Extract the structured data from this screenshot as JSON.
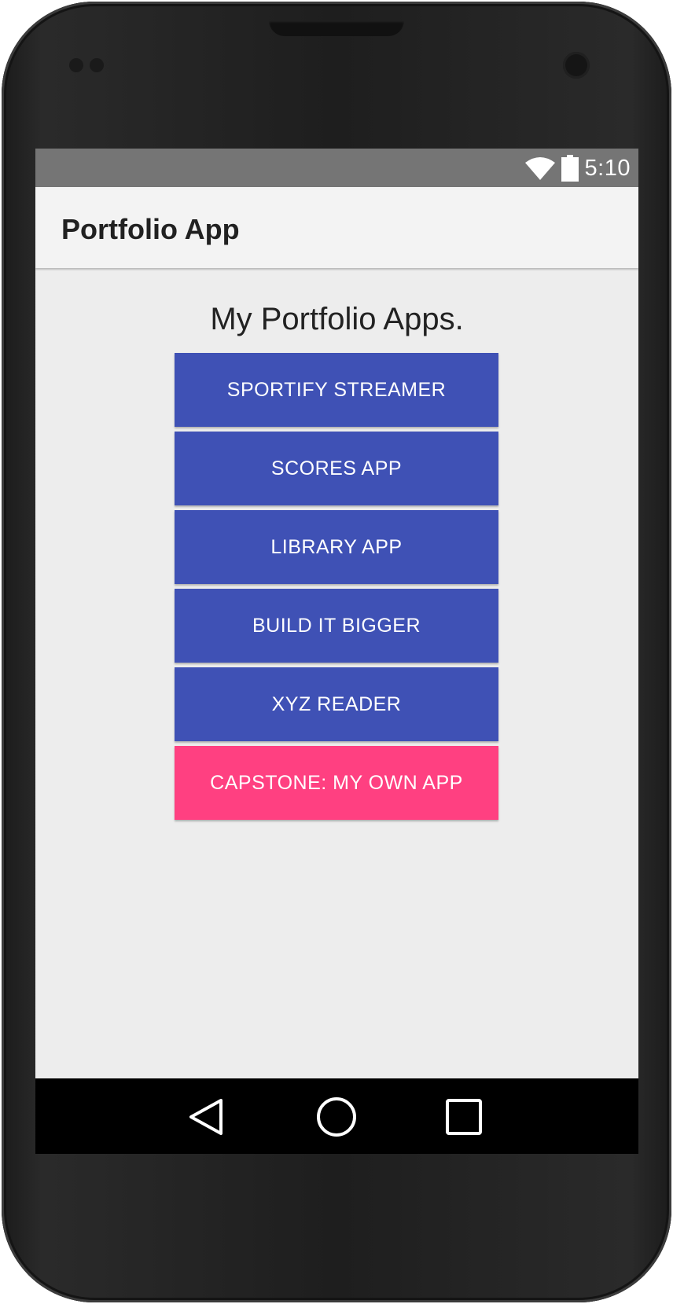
{
  "status_bar": {
    "time": "5:10",
    "icons": [
      "wifi-icon",
      "battery-icon"
    ]
  },
  "app_bar": {
    "title": "Portfolio App"
  },
  "main": {
    "heading": "My Portfolio Apps.",
    "buttons": [
      {
        "label": "SPORTIFY STREAMER",
        "color": "#3f51b5"
      },
      {
        "label": "SCORES APP",
        "color": "#3f51b5"
      },
      {
        "label": "LIBRARY APP",
        "color": "#3f51b5"
      },
      {
        "label": "BUILD IT BIGGER",
        "color": "#3f51b5"
      },
      {
        "label": "XYZ READER",
        "color": "#3f51b5"
      },
      {
        "label": "CAPSTONE: MY OWN APP",
        "color": "#ff4081"
      }
    ]
  },
  "nav_bar": {
    "buttons": [
      "back-icon",
      "home-icon",
      "recents-icon"
    ]
  },
  "colors": {
    "primary": "#3f51b5",
    "accent": "#ff4081",
    "status_bar": "#757575",
    "background": "#ededed"
  }
}
